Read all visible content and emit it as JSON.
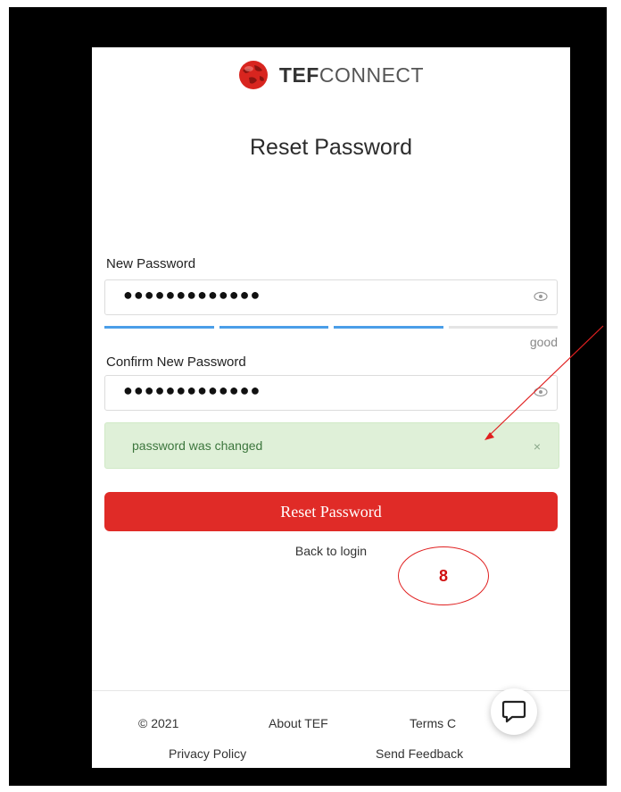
{
  "app": {
    "brand_bold": "TEF",
    "brand_rest": "CONNECT"
  },
  "page": {
    "title": "Reset Password"
  },
  "form": {
    "new_password_label": "New Password",
    "new_password_value": "●●●●●●●●●●●●●",
    "strength_label": "good",
    "strength_segments_filled": 3,
    "strength_segments_total": 4,
    "confirm_password_label": "Confirm New Password",
    "confirm_password_value": "●●●●●●●●●●●●●",
    "icons": {
      "visibility": "eye-icon"
    }
  },
  "alert": {
    "message": "password was changed",
    "close": "×"
  },
  "actions": {
    "submit": "Reset Password",
    "back": "Back to login"
  },
  "footer": {
    "copyright": "© 2021",
    "about": "About TEF",
    "terms": "Terms C",
    "privacy": "Privacy Policy",
    "feedback": "Send Feedback"
  },
  "annotation": {
    "number": "8"
  },
  "colors": {
    "primary": "#e02b27",
    "success_bg": "#dff0d8",
    "success_text": "#3c763d",
    "strength": "#4a9ee8",
    "annotation": "#e02020"
  }
}
